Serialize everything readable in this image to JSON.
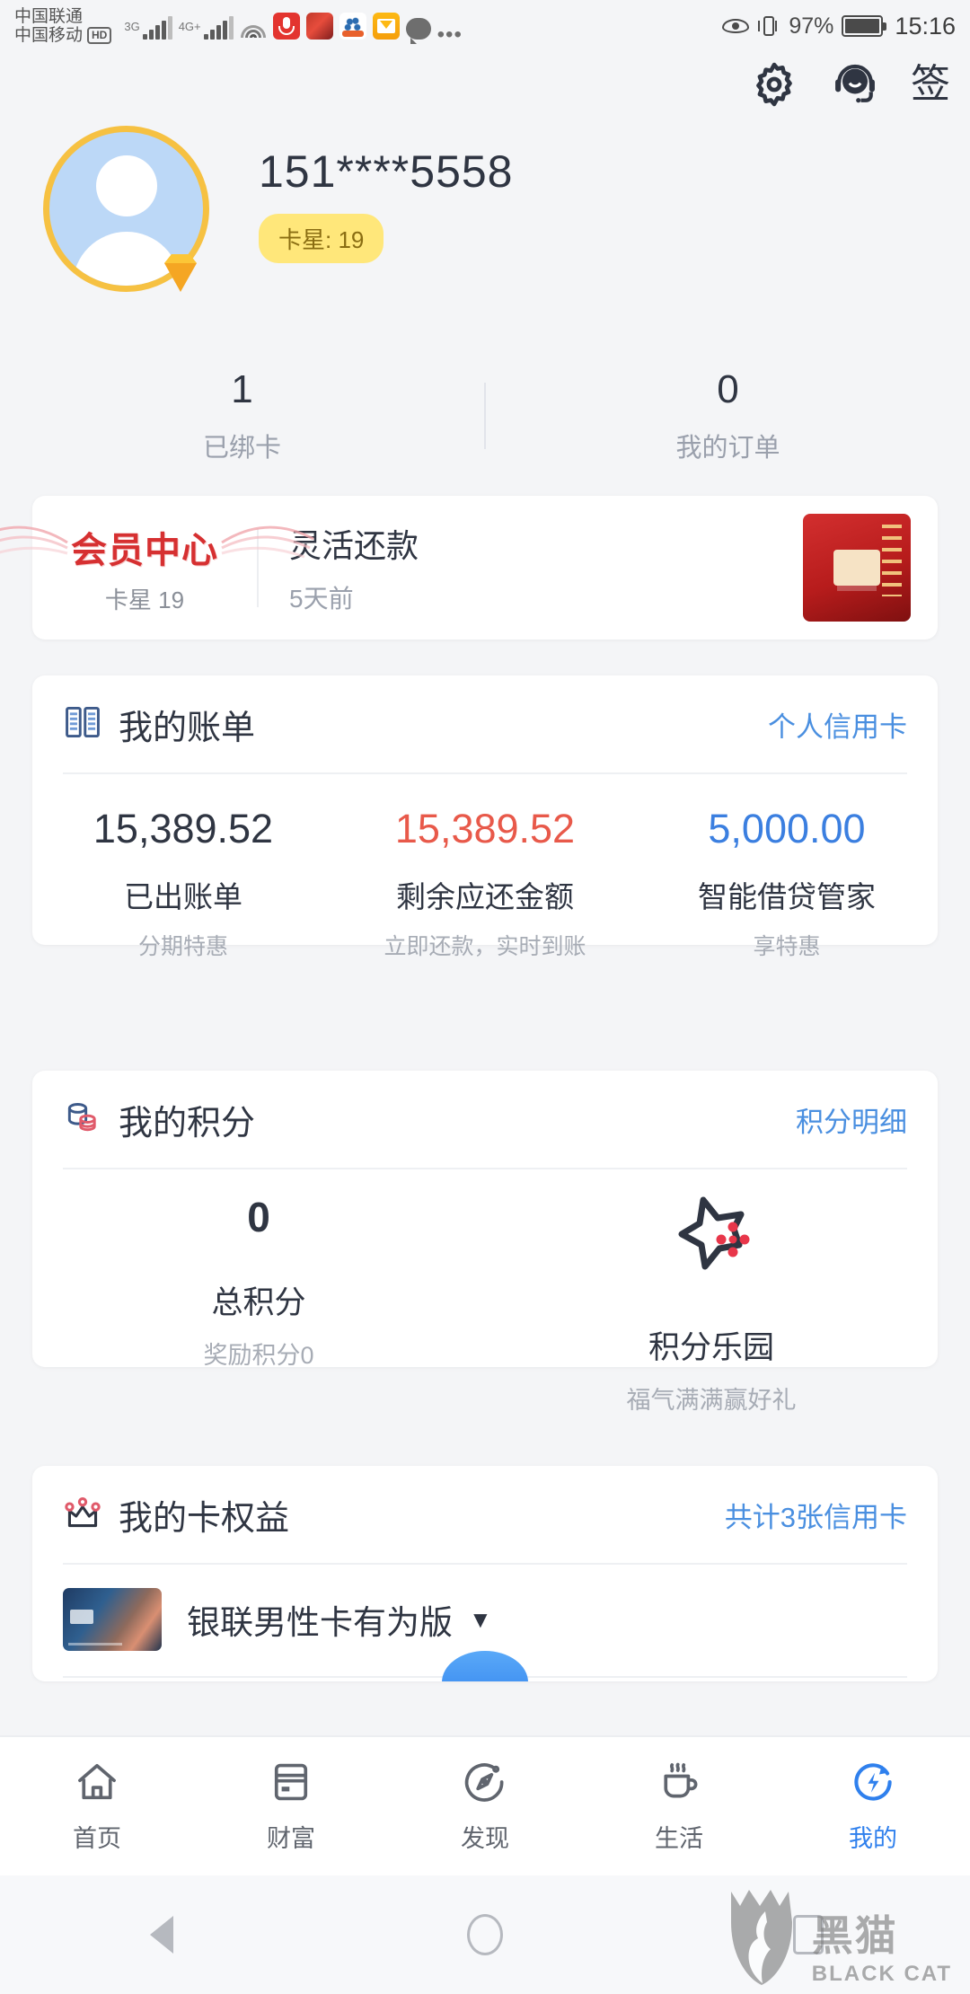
{
  "status_bar": {
    "carrier_primary": "中国联通",
    "carrier_secondary": "中国移动",
    "hd_badge": "HD",
    "network_1": "3G",
    "network_2": "4G+",
    "battery_percent": "97%",
    "time": "15:16",
    "overflow": "•••",
    "icons": [
      "signal-3g-icon",
      "signal-4g-plus-icon",
      "wifi-icon",
      "mic-app-icon",
      "red-app-icon",
      "baidu-app-icon",
      "mail-app-icon",
      "chat-bubble-icon",
      "eye-icon",
      "vibrate-icon",
      "battery-icon"
    ]
  },
  "header": {
    "settings_icon": "gear-icon",
    "service_icon": "headset-icon",
    "sign_label": "签"
  },
  "profile": {
    "phone": "151****5558",
    "star_badge": "卡星: 19",
    "avatar_icon": "avatar-icon",
    "gem_icon": "gem-icon"
  },
  "stats": [
    {
      "value": "1",
      "label": "已绑卡"
    },
    {
      "value": "0",
      "label": "我的订单"
    }
  ],
  "member_card": {
    "logo": "会员中心",
    "level": "卡星 19",
    "title": "灵活还款",
    "time": "5天前",
    "thumb_icon": "promo-thumbnail"
  },
  "bill_card": {
    "icon": "bill-book-icon",
    "title": "我的账单",
    "link": "个人信用卡",
    "columns": [
      {
        "amount": "15,389.52",
        "color": "#2f3542",
        "name": "已出账单",
        "sub": "分期特惠"
      },
      {
        "amount": "15,389.52",
        "color": "#e8594a",
        "name": "剩余应还金额",
        "sub": "立即还款，实时到账"
      },
      {
        "amount": "5,000.00",
        "color": "#3b7fe0",
        "name": "智能借贷管家",
        "sub": "享特惠"
      }
    ]
  },
  "points_card": {
    "icon": "coins-icon",
    "title": "我的积分",
    "link": "积分明细",
    "total_value": "0",
    "total_label": "总积分",
    "total_sub": "奖励积分0",
    "park_icon": "star-park-icon",
    "park_label": "积分乐园",
    "park_sub": "福气满满赢好礼"
  },
  "rights_card": {
    "icon": "crown-icon",
    "title": "我的卡权益",
    "link": "共计3张信用卡",
    "card_name": "银联男性卡有为版",
    "caret": "▼"
  },
  "tabbar": [
    {
      "label": "首页",
      "icon": "home-icon",
      "active": false
    },
    {
      "label": "财富",
      "icon": "card-icon",
      "active": false
    },
    {
      "label": "发现",
      "icon": "compass-icon",
      "active": false
    },
    {
      "label": "生活",
      "icon": "cup-icon",
      "active": false
    },
    {
      "label": "我的",
      "icon": "profile-bolt-icon",
      "active": true
    }
  ],
  "android_nav": {
    "back": "back-triangle-icon",
    "home": "home-circle-icon",
    "recents": "recents-square-icon"
  },
  "watermark": {
    "cn": "黑猫",
    "en": "BLACK CAT",
    "icon": "black-cat-logo"
  },
  "colors": {
    "accent_blue": "#2f80ed",
    "link_blue": "#4a8fe0",
    "red": "#e8594a",
    "gold": "#f6c142",
    "badge_bg": "#ffe77a",
    "bg": "#f4f5f7"
  }
}
